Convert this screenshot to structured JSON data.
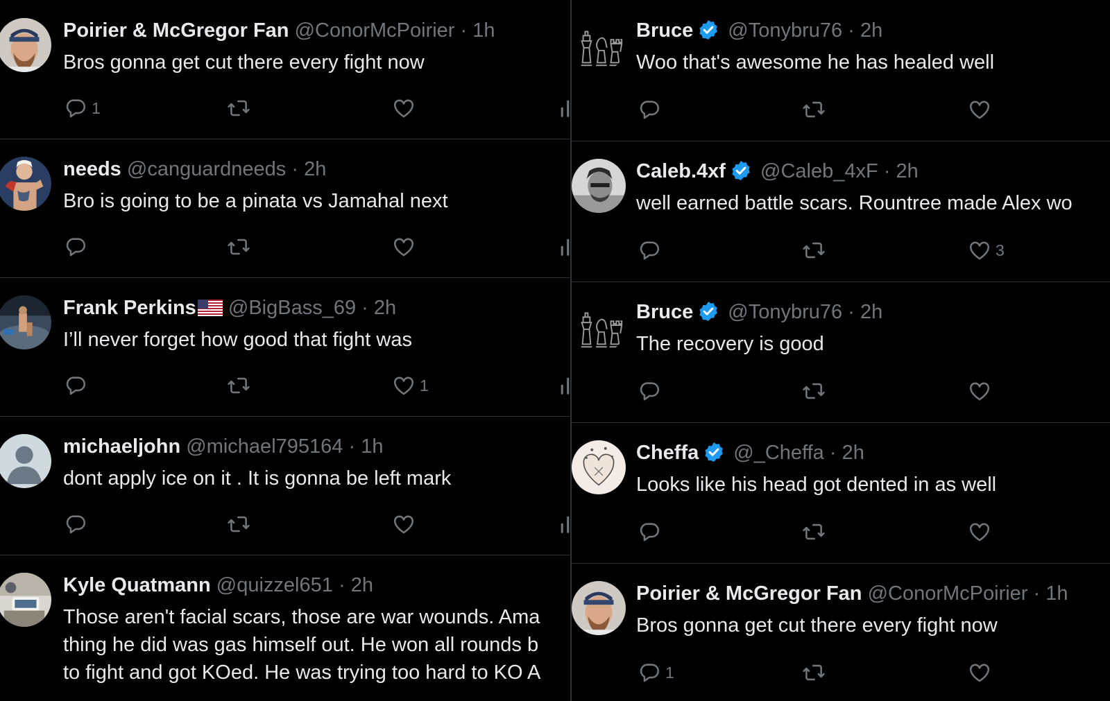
{
  "left": [
    {
      "name": "Poirier & McGregor Fan",
      "handle": "@ConorMcPoirier",
      "dot": "·",
      "time": "1h",
      "lines": [
        "Bros gonna get cut there every fight now"
      ],
      "reply_count": "1",
      "like_count": "",
      "avatar": "photo-man-cap"
    },
    {
      "name": "needs",
      "handle": "@canguardneeds",
      "dot": "·",
      "time": "2h",
      "lines": [
        "Bro is going to be a pinata vs Jamahal next"
      ],
      "reply_count": "",
      "like_count": "",
      "avatar": "photo-fighter-tattoo"
    },
    {
      "name": "Frank Perkins",
      "handle": "@BigBass_69",
      "dot": "·",
      "time": "2h",
      "lines": [
        "I’ll never forget how good that fight was"
      ],
      "reply_count": "",
      "like_count": "1",
      "avatar": "photo-octagon",
      "flag": "us-flag-icon"
    },
    {
      "name": "michaeljohn",
      "handle": "@michael795164",
      "dot": "·",
      "time": "1h",
      "lines": [
        "dont apply ice on it . It is gonna be left mark"
      ],
      "reply_count": "",
      "like_count": "",
      "avatar": "default-avatar"
    },
    {
      "name": "Kyle Quatmann",
      "handle": "@quizzel651",
      "dot": "·",
      "time": "2h",
      "lines": [
        "Those aren't facial scars, those are war wounds. Ama",
        "thing he did was gas himself out. He won all rounds b",
        "to fight and got KOed. He was trying too hard to KO A"
      ],
      "reply_count": "",
      "like_count": "",
      "avatar": "photo-room"
    }
  ],
  "right": [
    {
      "name": "Bruce",
      "handle": "@Tonybru76",
      "dot": "·",
      "time": "2h",
      "lines": [
        "Woo that's awesome he has healed well"
      ],
      "reply_count": "",
      "like_count": "",
      "avatar": "chess-pieces",
      "verified": true
    },
    {
      "name": "Caleb.4xf",
      "handle": "@Caleb_4xF",
      "dot": "·",
      "time": "2h",
      "lines": [
        "well earned battle scars. Rountree made Alex wo"
      ],
      "reply_count": "",
      "like_count": "3",
      "avatar": "photo-man-bw",
      "verified": true
    },
    {
      "name": "Bruce",
      "handle": "@Tonybru76",
      "dot": "·",
      "time": "2h",
      "lines": [
        "The recovery is good"
      ],
      "reply_count": "",
      "like_count": "",
      "avatar": "chess-pieces",
      "verified": true
    },
    {
      "name": "Cheffa",
      "handle": "@_Cheffa",
      "dot": "·",
      "time": "2h",
      "lines": [
        "Looks like his head got dented in as well"
      ],
      "reply_count": "",
      "like_count": "",
      "avatar": "heart-sketch",
      "verified": true
    },
    {
      "name": "Poirier & McGregor Fan",
      "handle": "@ConorMcPoirier",
      "dot": "·",
      "time": "1h",
      "lines": [
        "Bros gonna get cut there every fight now"
      ],
      "reply_count": "1",
      "like_count": "",
      "avatar": "photo-man-cap"
    }
  ],
  "colors": {
    "background": "#000000",
    "text": "#e7e9ea",
    "muted": "#71767b",
    "divider": "#2f3336",
    "verified": "#1d9bf0"
  }
}
